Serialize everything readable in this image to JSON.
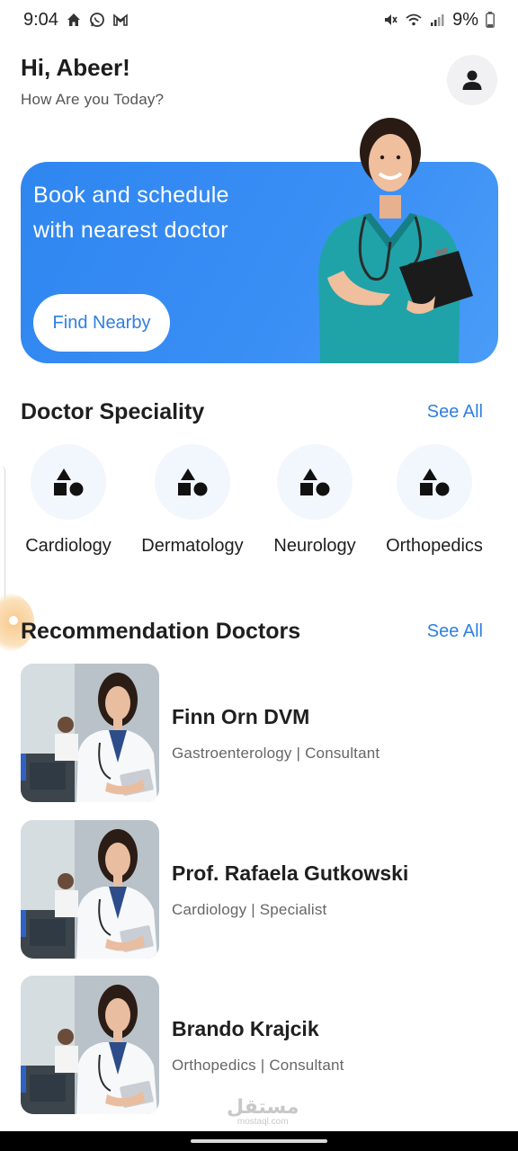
{
  "status_bar": {
    "time": "9:04",
    "battery": "9%",
    "icons_left": [
      "home-icon",
      "whatsapp-icon",
      "gmail-icon"
    ],
    "icons_right": [
      "mute-icon",
      "wifi-icon",
      "signal-icon",
      "battery-icon"
    ]
  },
  "greeting": {
    "title": "Hi, Abeer!",
    "subtitle": "How Are you Today?"
  },
  "banner": {
    "text": "Book and schedule with nearest doctor",
    "button_label": "Find Nearby"
  },
  "speciality": {
    "title": "Doctor Speciality",
    "see_all": "See All",
    "items": [
      {
        "label": "Cardiology"
      },
      {
        "label": "Dermatology"
      },
      {
        "label": "Neurology"
      },
      {
        "label": "Orthopedics"
      }
    ]
  },
  "recommendation": {
    "title": "Recommendation Doctors",
    "see_all": "See All",
    "doctors": [
      {
        "name": "Finn Orn DVM",
        "meta": "Gastroenterology | Consultant"
      },
      {
        "name": "Prof. Rafaela Gutkowski",
        "meta": "Cardiology | Specialist"
      },
      {
        "name": "Brando Krajcik",
        "meta": "Orthopedics | Consultant"
      }
    ]
  },
  "watermark": {
    "line1": "مستقل",
    "line2": "mostaql.com"
  },
  "colors": {
    "accent": "#2f7fe2",
    "banner": "#3a8ff5",
    "speciality_bg": "#f2f6fd"
  }
}
